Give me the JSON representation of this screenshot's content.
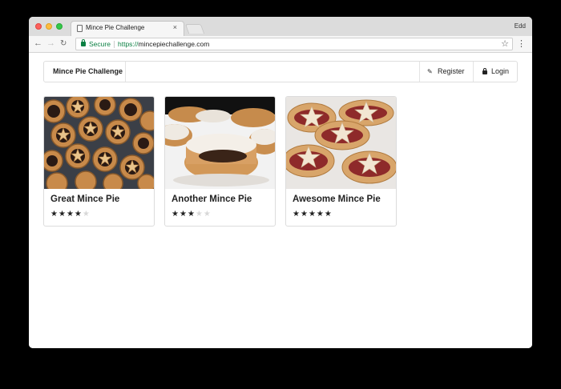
{
  "browser": {
    "tab_title": "Mince Pie Challenge",
    "tab_close": "×",
    "profile_name": "Edd",
    "secure_label": "Secure",
    "url_scheme": "https://",
    "url_host": "mincepiechallenge.com"
  },
  "navbar": {
    "brand": "Mince Pie Challenge",
    "register_label": "Register",
    "login_label": "Login"
  },
  "cards": [
    {
      "title": "Great Mince Pie",
      "rating": 4,
      "max_rating": 5
    },
    {
      "title": "Another Mince Pie",
      "rating": 3,
      "max_rating": 5
    },
    {
      "title": "Awesome Mince Pie",
      "rating": 5,
      "max_rating": 5
    }
  ],
  "icons": {
    "back": "back-arrow-icon",
    "forward": "forward-arrow-icon",
    "reload": "reload-icon",
    "bookmark": "star-bookmark-icon",
    "menu": "more-vert-icon",
    "register": "pencil-icon",
    "login": "lock-icon",
    "secure": "padlock-icon"
  },
  "colors": {
    "secure_green": "#0b8043",
    "star_filled": "#222222",
    "star_empty": "#d8d8d8"
  }
}
